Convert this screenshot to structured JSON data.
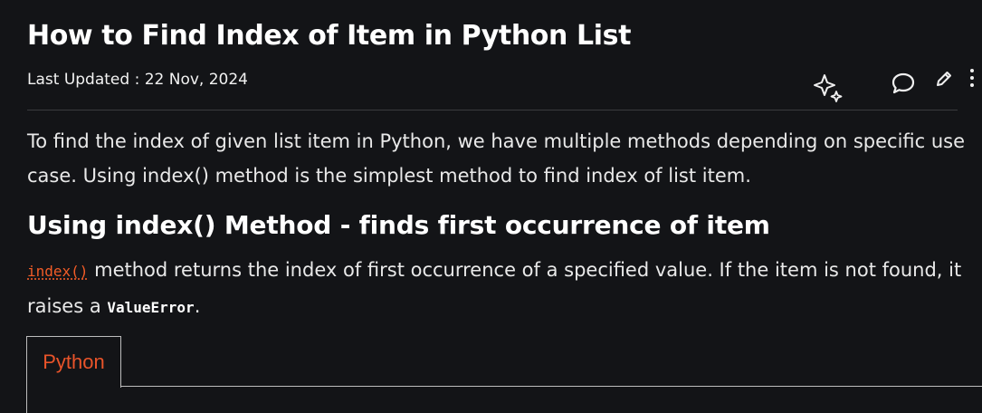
{
  "article": {
    "title": "How to Find Index of Item in Python List",
    "last_updated": "Last Updated : 22 Nov, 2024",
    "intro": "To find the index of given list item in Python, we have multiple methods depending on specific use case. Using index() method is the simplest method to find index of list item.",
    "section_heading": "Using index() Method - finds first occurrence of item",
    "section_link": "index()",
    "section_text_1": " method returns the index of first occurrence of a specified value. If the item is not found, it raises a ",
    "section_code": "ValueError",
    "section_text_2": "."
  },
  "actions": {
    "icons": [
      "ai-sparkle-icon",
      "comment-icon",
      "edit-icon",
      "more-options-icon"
    ]
  },
  "code_tabs": [
    {
      "label": "Python"
    }
  ],
  "colors": {
    "background": "#131417",
    "accent": "#f25c27",
    "text": "#e9e9e9"
  }
}
